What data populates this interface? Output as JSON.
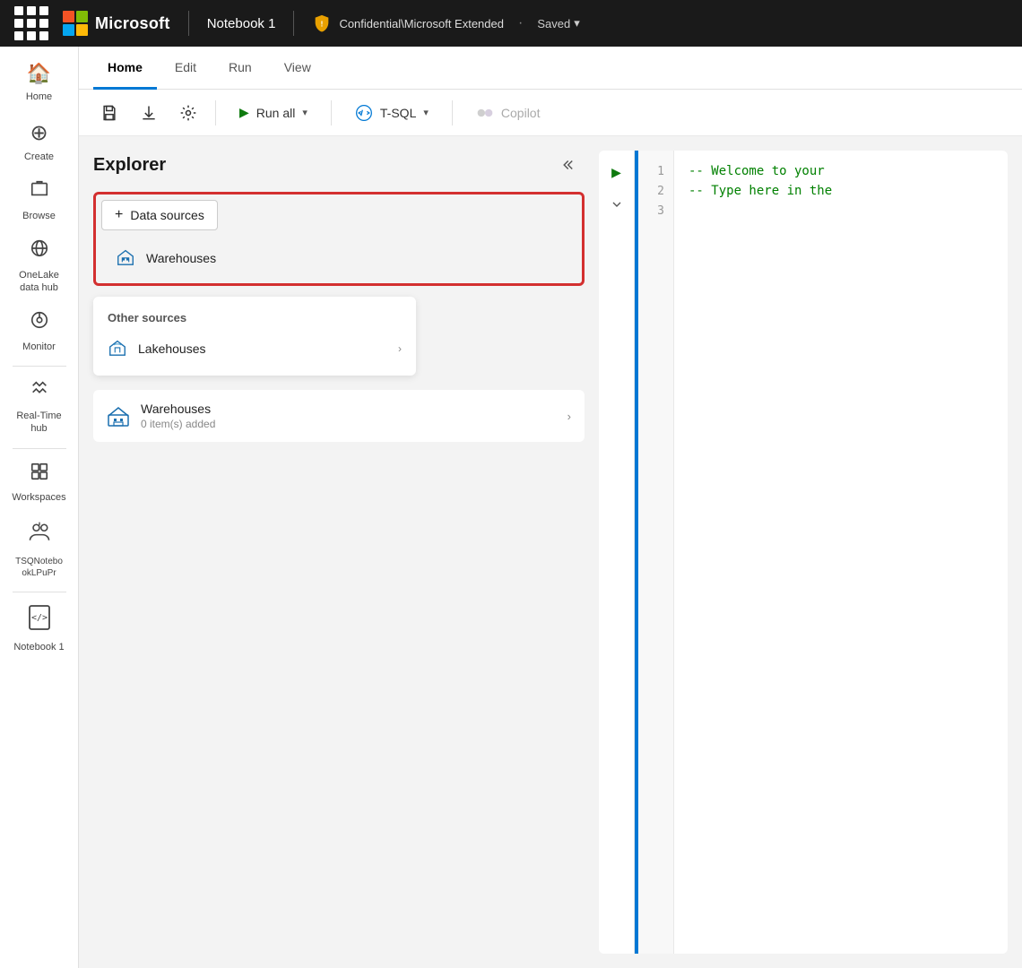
{
  "topbar": {
    "app_grid_label": "App launcher",
    "brand": "Microsoft",
    "notebook_name": "Notebook 1",
    "sensitivity": "Confidential\\Microsoft Extended",
    "save_status": "Saved",
    "dot": "·"
  },
  "tabs": {
    "items": [
      {
        "label": "Home",
        "active": true
      },
      {
        "label": "Edit",
        "active": false
      },
      {
        "label": "Run",
        "active": false
      },
      {
        "label": "View",
        "active": false
      }
    ]
  },
  "toolbar": {
    "run_all_label": "Run all",
    "tsql_label": "T-SQL",
    "copilot_label": "Copilot"
  },
  "sidebar": {
    "items": [
      {
        "label": "Home",
        "icon": "🏠"
      },
      {
        "label": "Create",
        "icon": "⊕"
      },
      {
        "label": "Browse",
        "icon": "📁"
      },
      {
        "label": "OneLake\ndata hub",
        "icon": "🌐"
      },
      {
        "label": "Monitor",
        "icon": "📊"
      },
      {
        "label": "Real-Time\nhub",
        "icon": "🛰"
      },
      {
        "label": "Workspaces",
        "icon": "⬜"
      },
      {
        "label": "TSQNotebo\nokLPuPr",
        "icon": "👥"
      },
      {
        "label": "Notebook 1",
        "icon": "</>"
      }
    ]
  },
  "explorer": {
    "title": "Explorer",
    "collapse_tooltip": "Collapse",
    "datasources_btn": "Data sources",
    "dropdown": {
      "warehouses_label": "Warehouses",
      "other_sources_label": "Other sources",
      "lakehouses_label": "Lakehouses"
    },
    "items": [
      {
        "name": "Warehouses",
        "subtitle": "0 item(s) added"
      }
    ]
  },
  "editor": {
    "lines": [
      {
        "num": "1",
        "code": "-- Welcome to your"
      },
      {
        "num": "2",
        "code": "-- Type here in the"
      },
      {
        "num": "3",
        "code": ""
      }
    ]
  }
}
